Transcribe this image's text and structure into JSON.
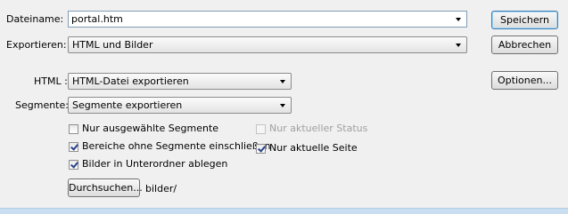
{
  "filename": {
    "label": "Dateiname:",
    "value": "portal.htm"
  },
  "export": {
    "label": "Exportieren:",
    "value": "HTML und Bilder"
  },
  "html": {
    "label": "HTML :",
    "value": "HTML-Datei exportieren"
  },
  "segments": {
    "label": "Segmente:",
    "value": "Segmente exportieren"
  },
  "buttons": {
    "save": "Speichern",
    "cancel": "Abbrechen",
    "options": "Optionen...",
    "browse": "Durchsuchen..."
  },
  "options": {
    "selected_segments_only": {
      "label": "Nur ausgewählte Segmente",
      "checked": false
    },
    "current_state_only": {
      "label": "Nur aktueller Status",
      "checked": false,
      "disabled": true
    },
    "areas_without_segments": {
      "label": "Bereiche ohne Segmente einschließen",
      "checked": true
    },
    "current_page_only": {
      "label": "Nur aktuelle Seite",
      "checked": true
    },
    "images_in_subfolder": {
      "label": "Bilder in Unterordner ablegen",
      "checked": true
    }
  },
  "folder": {
    "path": "bilder/"
  }
}
